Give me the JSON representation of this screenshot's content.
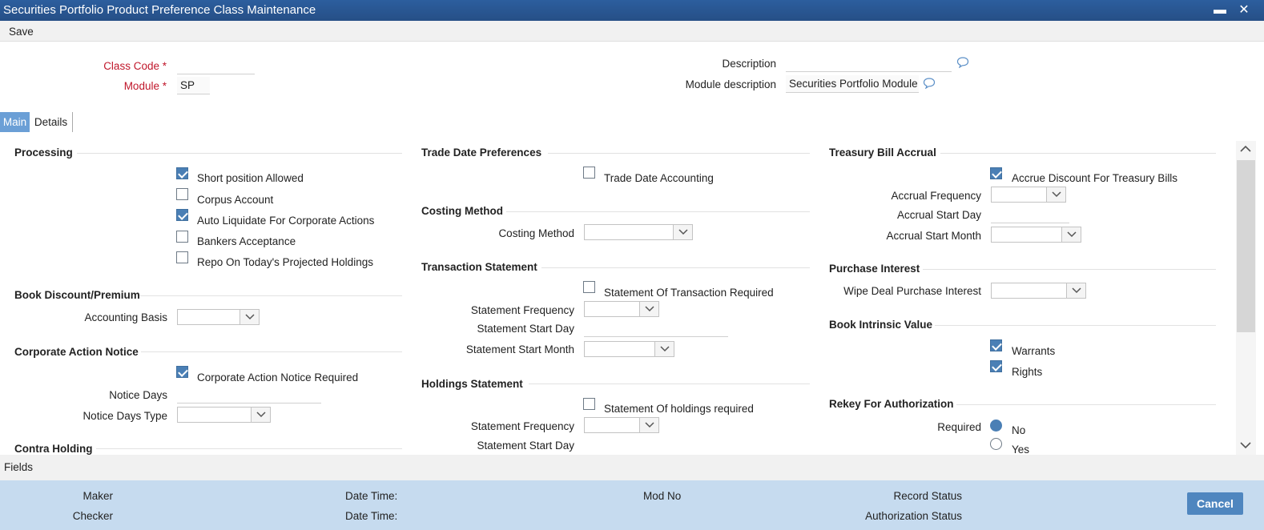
{
  "window": {
    "title": "Securities Portfolio Product Preference Class Maintenance",
    "minimize": "▬",
    "close": "✕"
  },
  "toolbar": {
    "save_label": "Save"
  },
  "header": {
    "class_code_label": "Class Code",
    "class_code_value": "",
    "module_label": "Module",
    "module_value": "SP",
    "required_marker": "*",
    "description_label": "Description",
    "description_value": "",
    "module_description_label": "Module description",
    "module_description_value": "Securities Portfolio Module"
  },
  "tabs": [
    {
      "label": "Main"
    },
    {
      "label": "Details"
    }
  ],
  "processing": {
    "title": "Processing",
    "options": [
      {
        "label": "Short position Allowed",
        "checked": true
      },
      {
        "label": "Corpus Account",
        "checked": false
      },
      {
        "label": "Auto Liquidate For Corporate Actions",
        "checked": true
      },
      {
        "label": "Bankers Acceptance",
        "checked": false
      },
      {
        "label": "Repo On Today's Projected Holdings",
        "checked": false
      }
    ]
  },
  "book_discount": {
    "title": "Book Discount/Premium",
    "accounting_basis_label": "Accounting Basis",
    "accounting_basis_value": ""
  },
  "corporate_action": {
    "title": "Corporate Action Notice",
    "notice_required_label": "Corporate Action Notice Required",
    "notice_required_checked": true,
    "notice_days_label": "Notice Days",
    "notice_days_value": "",
    "notice_days_type_label": "Notice Days Type",
    "notice_days_type_value": ""
  },
  "contra_holding": {
    "title": "Contra Holding"
  },
  "trade_date": {
    "title": "Trade Date Preferences",
    "accounting_label": "Trade Date Accounting",
    "accounting_checked": false
  },
  "costing": {
    "title": "Costing Method",
    "method_label": "Costing Method",
    "method_value": ""
  },
  "transaction_statement": {
    "title": "Transaction Statement",
    "required_label": "Statement Of Transaction Required",
    "required_checked": false,
    "frequency_label": "Statement Frequency",
    "start_day_label": "Statement Start Day",
    "start_month_label": "Statement Start Month"
  },
  "holdings_statement": {
    "title": "Holdings Statement",
    "required_label": "Statement Of holdings required",
    "required_checked": false,
    "frequency_label": "Statement Frequency",
    "start_day_label": "Statement Start Day"
  },
  "treasury": {
    "title": "Treasury Bill Accrual",
    "accrue_label": "Accrue Discount For Treasury Bills",
    "accrue_checked": true,
    "frequency_label": "Accrual Frequency",
    "start_day_label": "Accrual Start Day",
    "start_month_label": "Accrual Start Month"
  },
  "purchase_interest": {
    "title": "Purchase Interest",
    "wipe_label": "Wipe Deal Purchase Interest"
  },
  "intrinsic": {
    "title": "Book Intrinsic Value",
    "warrants_label": "Warrants",
    "warrants_checked": true,
    "rights_label": "Rights",
    "rights_checked": true
  },
  "rekey": {
    "title": "Rekey For Authorization",
    "required_label": "Required",
    "no_label": "No",
    "yes_label": "Yes",
    "selected": "No"
  },
  "fields_bar": {
    "label": "Fields"
  },
  "footer": {
    "maker_label": "Maker",
    "checker_label": "Checker",
    "datetime_label_1": "Date Time:",
    "datetime_label_2": "Date Time:",
    "mod_no_label": "Mod No",
    "record_status_label": "Record Status",
    "auth_status_label": "Authorization Status",
    "cancel_label": "Cancel"
  },
  "colors": {
    "title_bar": "#2c5e9e",
    "accent": "#4a7fb5",
    "required": "#c0172b",
    "footer": "#c6dbef"
  }
}
